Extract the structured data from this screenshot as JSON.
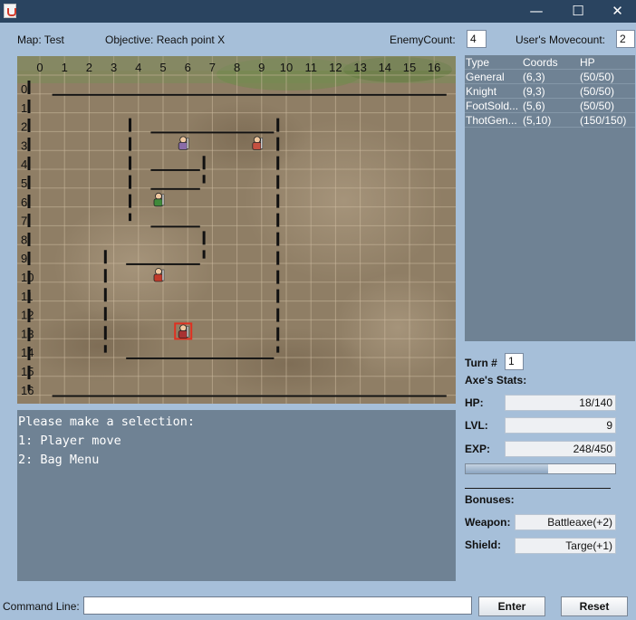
{
  "window": {
    "title": "",
    "min_icon": "minimize-icon",
    "max_icon": "maximize-icon",
    "close_icon": "close-icon"
  },
  "header": {
    "map_label": "Map: Test",
    "objective_label": "Objective: Reach point X",
    "enemy_count_label": "EnemyCount:",
    "enemy_count_value": "4",
    "movecount_label": "User's Movecount:",
    "movecount_value": "2"
  },
  "board": {
    "columns": [
      "0",
      "1",
      "2",
      "3",
      "4",
      "5",
      "6",
      "7",
      "8",
      "9",
      "10",
      "11",
      "12",
      "13",
      "14",
      "15",
      "16"
    ],
    "rows": [
      "0",
      "1",
      "2",
      "3",
      "4",
      "5",
      "6",
      "7",
      "8",
      "9",
      "10",
      "11",
      "12",
      "13",
      "14",
      "15",
      "16"
    ],
    "units": [
      {
        "name": "general",
        "col": 6,
        "row": 3,
        "color": "#8a6ca8"
      },
      {
        "name": "knight",
        "col": 9,
        "row": 3,
        "color": "#c45040"
      },
      {
        "name": "footsoldier",
        "col": 5,
        "row": 6,
        "color": "#3f8a3a"
      },
      {
        "name": "thotgeneral",
        "col": 5,
        "row": 10,
        "color": "#c23a2a"
      },
      {
        "name": "player-axe",
        "col": 6,
        "row": 13,
        "color": "#a83232"
      }
    ]
  },
  "console": {
    "lines": [
      "Please make a selection:",
      "1: Player move",
      "2: Bag Menu"
    ]
  },
  "units_table": {
    "headers": [
      "Type",
      "Coords",
      "HP"
    ],
    "rows": [
      [
        "General",
        "(6,3)",
        "(50/50)"
      ],
      [
        "Knight",
        "(9,3)",
        "(50/50)"
      ],
      [
        "FootSold...",
        "(5,6)",
        "(50/50)"
      ],
      [
        "ThotGen...",
        "(5,10)",
        "(150/150)"
      ]
    ]
  },
  "stats": {
    "turn_label": "Turn #",
    "turn_value": "1",
    "title": "Axe's Stats:",
    "hp_label": "HP:",
    "hp_value": "18/140",
    "lvl_label": "LVL:",
    "lvl_value": "9",
    "exp_label": "EXP:",
    "exp_value": "248/450",
    "exp_progress": 0.551,
    "bonuses_label": "Bonuses:",
    "weapon_label": "Weapon:",
    "weapon_value": "Battleaxe(+2)",
    "shield_label": "Shield:",
    "shield_value": "Targe(+1)"
  },
  "command": {
    "label": "Command Line:",
    "value": "",
    "enter_label": "Enter",
    "reset_label": "Reset"
  }
}
